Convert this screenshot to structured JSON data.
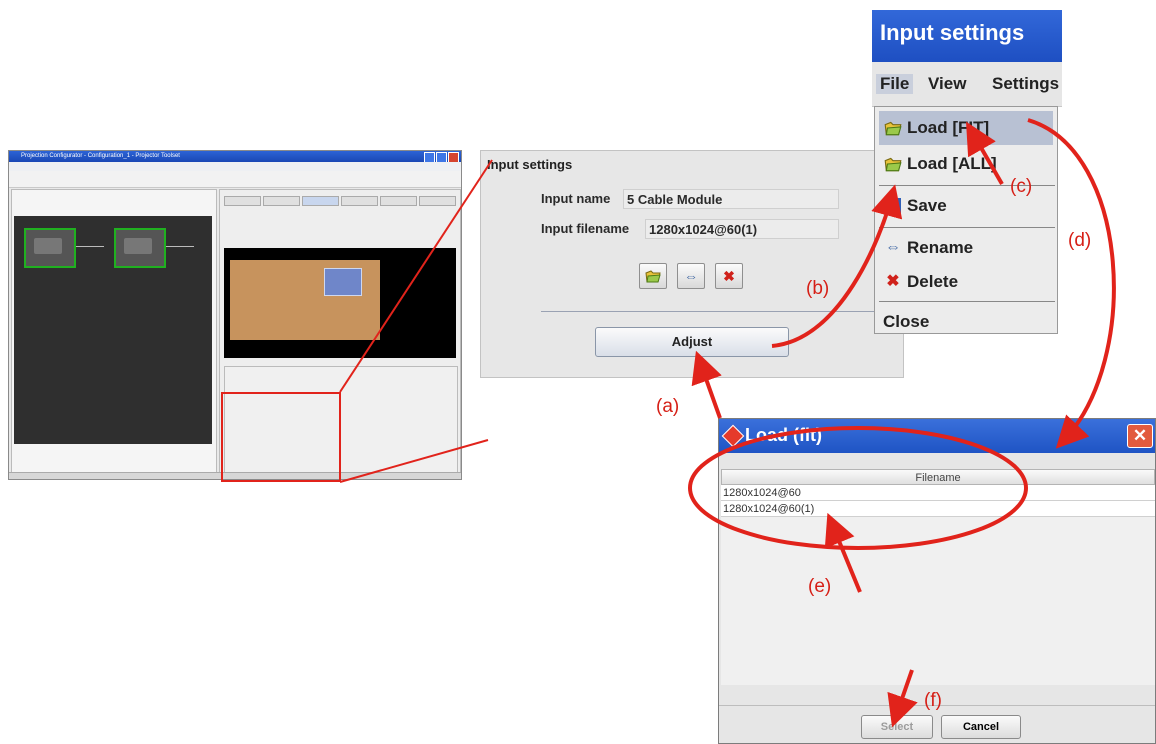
{
  "thumbnail": {
    "window_title": "Projection Configurator - Configuration_1 - Projector Toolset"
  },
  "input_settings": {
    "title": "Input settings",
    "input_name_label": "Input name",
    "input_name_value": "5 Cable Module",
    "input_filename_label": "Input filename",
    "input_filename_value": "1280x1024@60(1)",
    "icons": [
      "load-icon",
      "rename-icon",
      "delete-icon"
    ],
    "adjust_label": "Adjust"
  },
  "file_menu": {
    "window_title": "Input settings",
    "menubar": [
      "File",
      "View",
      "Settings"
    ],
    "items": [
      {
        "label": "Load [FIT]",
        "icon": "load-icon"
      },
      {
        "label": "Load [ALL]",
        "icon": "load-icon"
      },
      {
        "label": "Save",
        "icon": "save-icon"
      },
      {
        "label": "Rename",
        "icon": "rename-icon"
      },
      {
        "label": "Delete",
        "icon": "delete-icon"
      },
      {
        "label": "Close",
        "icon": ""
      }
    ]
  },
  "load_dialog": {
    "title": "Load (fit)",
    "column_header": "Filename",
    "rows": [
      "1280x1024@60",
      "1280x1024@60(1)"
    ],
    "select_label": "Select",
    "cancel_label": "Cancel"
  },
  "callouts": {
    "a": "(a)",
    "b": "(b)",
    "c": "(c)",
    "d": "(d)",
    "e": "(e)",
    "f": "(f)"
  },
  "colors": {
    "annotation_red": "#e1231b",
    "titlebar_blue": "#2a5fd0"
  }
}
